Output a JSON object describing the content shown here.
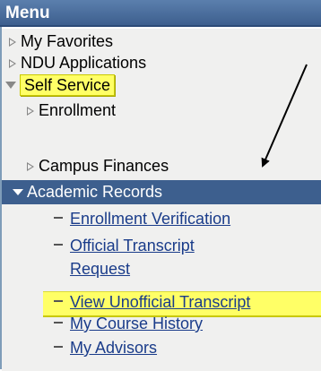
{
  "menu": {
    "title": "Menu",
    "items": [
      {
        "label": "My Favorites",
        "state": "collapsed"
      },
      {
        "label": "NDU Applications",
        "state": "collapsed"
      },
      {
        "label": "Self Service",
        "state": "expanded",
        "highlighted": true
      }
    ],
    "self_service_children": [
      {
        "label": "Enrollment",
        "state": "collapsed"
      },
      {
        "label": "Campus Finances",
        "state": "collapsed"
      },
      {
        "label": "Academic Records",
        "state": "expanded",
        "selected": true
      }
    ],
    "academic_records_links": [
      {
        "label": "Enrollment Verification"
      },
      {
        "label_line1": "Official Transcript",
        "label_line2": "Request"
      },
      {
        "label": "View Unofficial Transcript",
        "highlighted": true
      },
      {
        "label": "My Course History"
      },
      {
        "label": "My Advisors"
      }
    ]
  },
  "colors": {
    "header_bg": "#3d5f8e",
    "selected_bg": "#3d5f8e",
    "highlight": "#ffff66",
    "link": "#1a3c8a",
    "panel_bg": "#f0f0ef"
  },
  "icons": {
    "collapsed": "triangle-right-icon",
    "expanded": "triangle-down-icon",
    "link_bullet": "dash-icon",
    "annotation": "arrow-icon"
  }
}
